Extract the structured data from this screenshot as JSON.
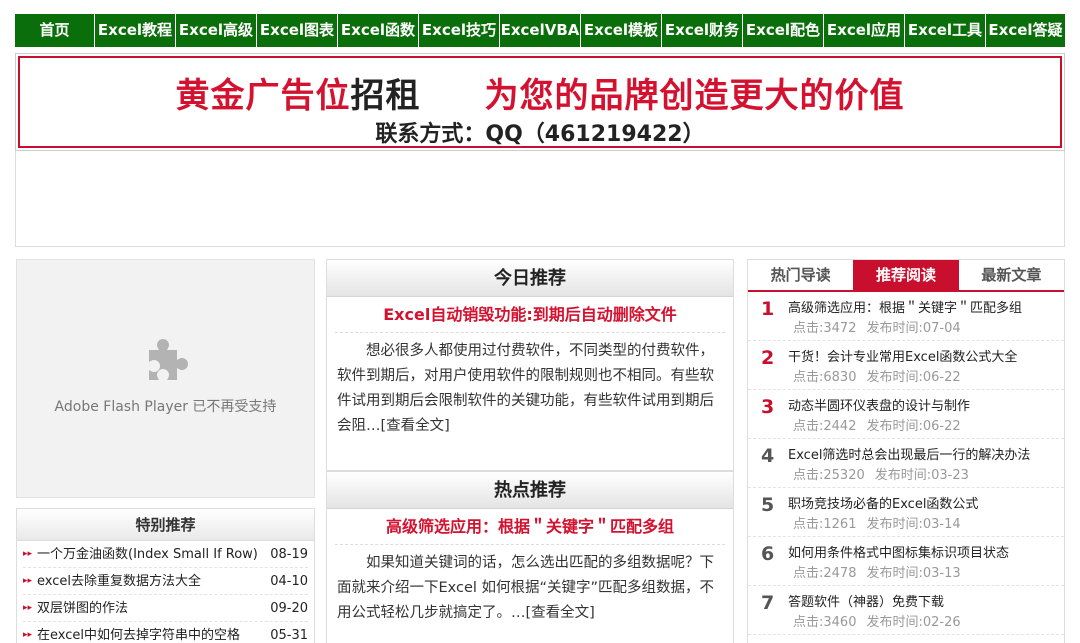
{
  "nav": [
    "首页",
    "Excel教程",
    "Excel高级",
    "Excel图表",
    "Excel函数",
    "Excel技巧",
    "ExcelVBA",
    "Excel模板",
    "Excel财务",
    "Excel配色",
    "Excel应用",
    "Excel工具",
    "Excel答疑"
  ],
  "banner": {
    "line1_red_a": "黄金广告位",
    "line1_dark": "招租",
    "line1_red_b": "为您的品牌创造更大的价值",
    "line2": "联系方式：QQ（461219422）"
  },
  "flash": {
    "text": "Adobe Flash Player 已不再受支持",
    "icon": "puzzle-piece-icon"
  },
  "special": {
    "title": "特别推荐",
    "items": [
      {
        "title": "一个万金油函数(Index Small If Row)",
        "date": "08-19"
      },
      {
        "title": "excel去除重复数据方法大全",
        "date": "04-10"
      },
      {
        "title": "双层饼图的作法",
        "date": "09-20"
      },
      {
        "title": "在excel中如何去掉字符串中的空格",
        "date": "05-31"
      }
    ]
  },
  "today": {
    "header": "今日推荐",
    "title": "Excel自动销毁功能:到期后自动删除文件",
    "body": "想必很多人都使用过付费软件，不同类型的付费软件，软件到期后，对用户使用软件的限制规则也不相同。有些软件试用到期后会限制软件的关键功能，有些软件试用到期后会阻…",
    "more": "[查看全文]"
  },
  "hot": {
    "header": "热点推荐",
    "title": "高级筛选应用：根据＂关键字＂匹配多组",
    "body": "如果知道关键词的话，怎么选出匹配的多组数据呢？下面就来介绍一下Excel 如何根据“关键字”匹配多组数据，不用公式轻松几步就搞定了。…",
    "more": "[查看全文]"
  },
  "rank": {
    "tabs": [
      "热门导读",
      "推荐阅读",
      "最新文章"
    ],
    "active_tab": 1,
    "clicks_label": "点击:",
    "time_label": "发布时间:",
    "items": [
      {
        "num": "1",
        "title": "高级筛选应用：根据＂关键字＂匹配多组",
        "clicks": "3472",
        "time": "07-04"
      },
      {
        "num": "2",
        "title": "干货！会计专业常用Excel函数公式大全",
        "clicks": "6830",
        "time": "06-22"
      },
      {
        "num": "3",
        "title": "动态半圆环仪表盘的设计与制作",
        "clicks": "2442",
        "time": "06-22"
      },
      {
        "num": "4",
        "title": "Excel筛选时总会出现最后一行的解决办法",
        "clicks": "25320",
        "time": "03-23"
      },
      {
        "num": "5",
        "title": "职场竞技场必备的Excel函数公式",
        "clicks": "1261",
        "time": "03-14"
      },
      {
        "num": "6",
        "title": "如何用条件格式中图标集标识项目状态",
        "clicks": "2478",
        "time": "03-13"
      },
      {
        "num": "7",
        "title": "答题软件（神器）免费下载",
        "clicks": "3460",
        "time": "02-26"
      }
    ]
  },
  "colors": {
    "nav_bg": "#0a6e0a",
    "accent_red": "#c8102e"
  }
}
